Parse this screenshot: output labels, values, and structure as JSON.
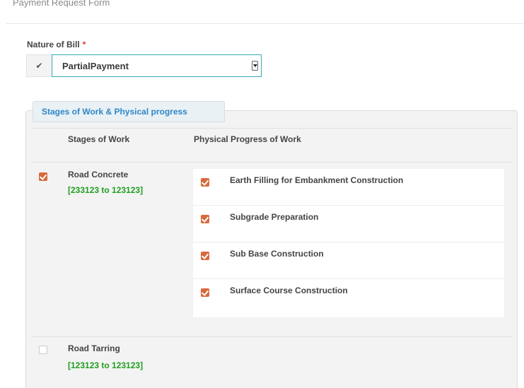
{
  "form": {
    "title": "Payment Request Form"
  },
  "nature_of_bill": {
    "label": "Nature of Bill",
    "required_marker": "*",
    "selected_value": "PartialPayment"
  },
  "panel": {
    "tab_title": "Stages of Work & Physical progress",
    "col_stages": "Stages of Work",
    "col_progress": "Physical Progress of Work"
  },
  "stages": [
    {
      "name": "Road Concrete",
      "range": "[233123 to 123123]",
      "checked": true,
      "progress": [
        {
          "label": "Earth Filling for Embankment Construction",
          "checked": true
        },
        {
          "label": "Subgrade Preparation",
          "checked": true
        },
        {
          "label": "Sub Base Construction",
          "checked": true
        },
        {
          "label": "Surface Course Construction",
          "checked": true
        }
      ]
    },
    {
      "name": "Road Tarring",
      "range": "[123123 to 123123]",
      "checked": false
    }
  ],
  "colors": {
    "accent_orange": "#d86a3c",
    "range_green": "#1e9e1e",
    "tab_blue": "#2f86c6",
    "select_border": "#39a9b5",
    "required_red": "#e0342f"
  }
}
